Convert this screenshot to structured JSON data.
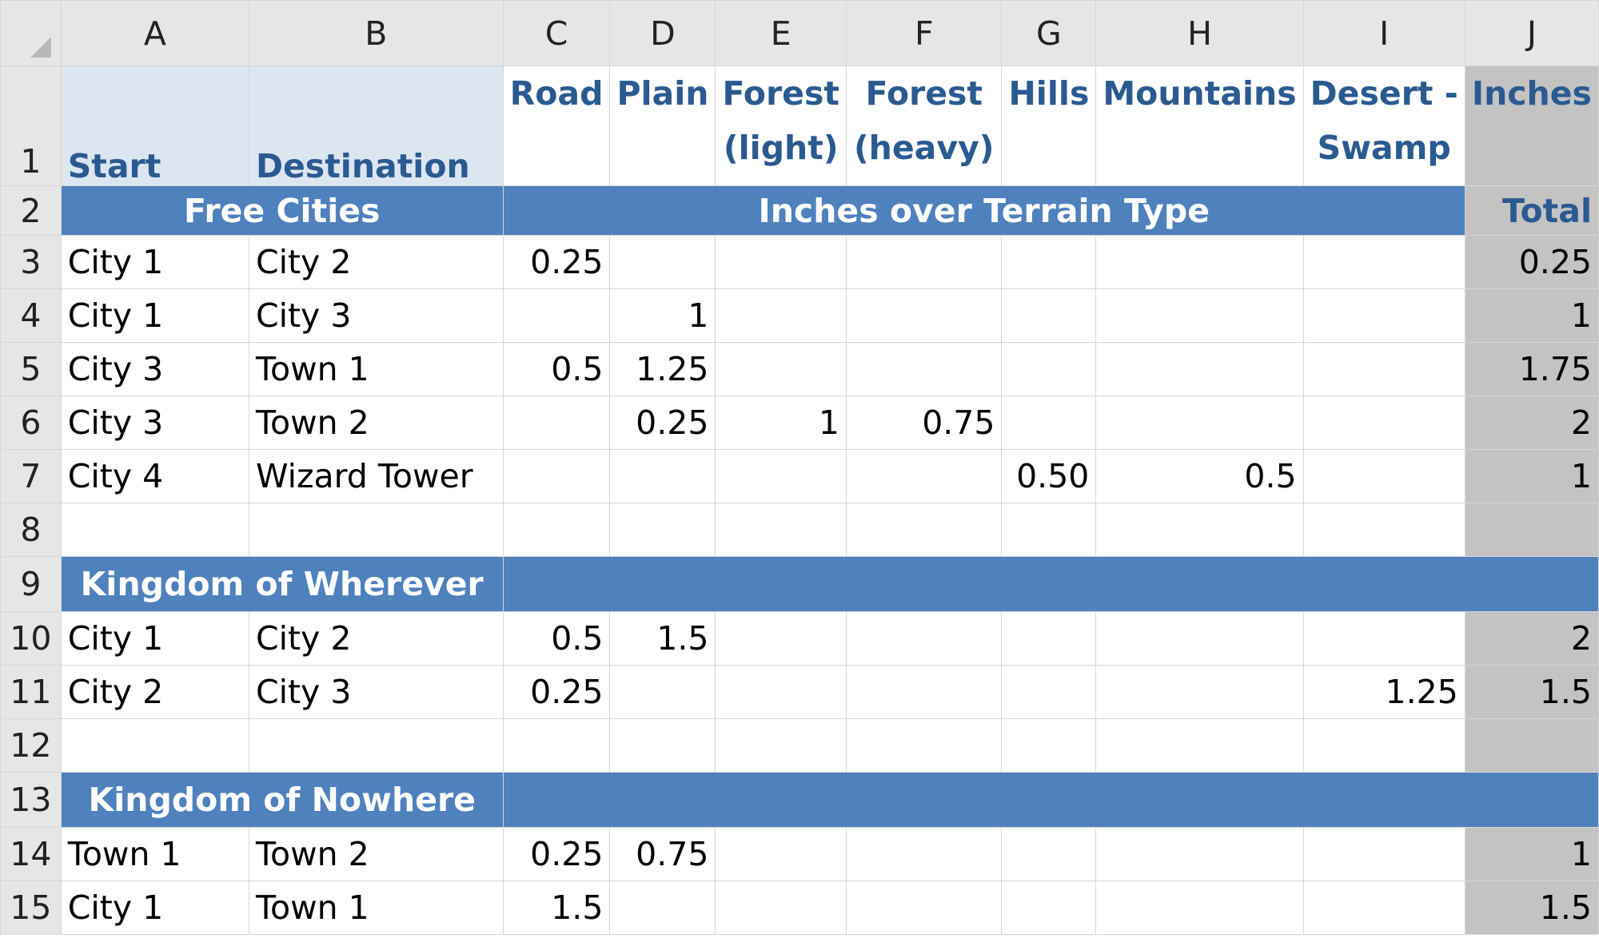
{
  "columns": [
    "A",
    "B",
    "C",
    "D",
    "E",
    "F",
    "G",
    "H",
    "I",
    "J"
  ],
  "header_row": {
    "row_number": "1",
    "start": "Start",
    "destination": "Destination",
    "terrain": [
      {
        "line1": "Road",
        "line2": ""
      },
      {
        "line1": "Plain",
        "line2": ""
      },
      {
        "line1": "Forest",
        "line2": "(light)"
      },
      {
        "line1": "Forest",
        "line2": "(heavy)"
      },
      {
        "line1": "Hills",
        "line2": ""
      },
      {
        "line1": "Mountains",
        "line2": ""
      },
      {
        "line1": "Desert -",
        "line2": "Swamp"
      }
    ],
    "inches": "Inches"
  },
  "band_row": {
    "row_number": "2",
    "free_cities": "Free Cities",
    "inches_over_terrain": "Inches over Terrain Type",
    "total": "Total"
  },
  "rows": [
    {
      "n": "3",
      "start": "City 1",
      "dest": "City 2",
      "vals": [
        "0.25",
        "",
        "",
        "",
        "",
        "",
        ""
      ],
      "total": "0.25"
    },
    {
      "n": "4",
      "start": "City 1",
      "dest": "City 3",
      "vals": [
        "",
        "1",
        "",
        "",
        "",
        "",
        ""
      ],
      "total": "1"
    },
    {
      "n": "5",
      "start": "City 3",
      "dest": "Town 1",
      "vals": [
        "0.5",
        "1.25",
        "",
        "",
        "",
        "",
        ""
      ],
      "total": "1.75"
    },
    {
      "n": "6",
      "start": "City 3",
      "dest": "Town 2",
      "vals": [
        "",
        "0.25",
        "1",
        "0.75",
        "",
        "",
        ""
      ],
      "total": "2"
    },
    {
      "n": "7",
      "start": "City 4",
      "dest": "Wizard Tower",
      "vals": [
        "",
        "",
        "",
        "",
        "0.50",
        "0.5",
        ""
      ],
      "total": "1"
    },
    {
      "n": "8",
      "start": "",
      "dest": "",
      "vals": [
        "",
        "",
        "",
        "",
        "",
        "",
        ""
      ],
      "total": ""
    },
    {
      "n": "9",
      "section": "Kingdom of Wherever"
    },
    {
      "n": "10",
      "start": "City 1",
      "dest": "City 2",
      "vals": [
        "0.5",
        "1.5",
        "",
        "",
        "",
        "",
        ""
      ],
      "total": "2"
    },
    {
      "n": "11",
      "start": "City 2",
      "dest": "City 3",
      "vals": [
        "0.25",
        "",
        "",
        "",
        "",
        "",
        "1.25"
      ],
      "total": "1.5"
    },
    {
      "n": "12",
      "start": "",
      "dest": "",
      "vals": [
        "",
        "",
        "",
        "",
        "",
        "",
        ""
      ],
      "total": ""
    },
    {
      "n": "13",
      "section": "Kingdom of Nowhere"
    },
    {
      "n": "14",
      "start": "Town 1",
      "dest": "Town 2",
      "vals": [
        "0.25",
        "0.75",
        "",
        "",
        "",
        "",
        ""
      ],
      "total": "1"
    },
    {
      "n": "15",
      "start": "City 1",
      "dest": "Town 1",
      "vals": [
        "1.5",
        "",
        "",
        "",
        "",
        "",
        ""
      ],
      "total": "1.5"
    }
  ],
  "colors": {
    "band_blue": "#4f81bd",
    "header_text_blue": "#2b5a91",
    "label_fill": "#dce6f1",
    "total_gray": "#c3c3c3",
    "heading_gray": "#e6e6e6"
  }
}
